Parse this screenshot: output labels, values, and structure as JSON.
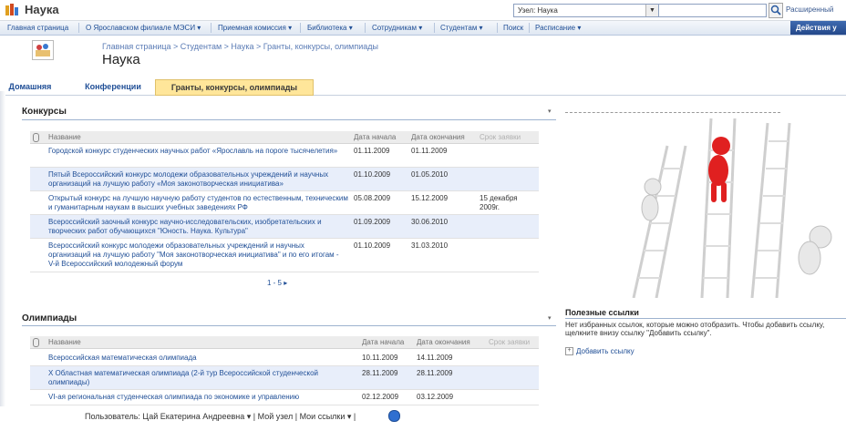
{
  "app": {
    "title": "Наука"
  },
  "search": {
    "scope": "Узел: Наука",
    "value": "",
    "advanced": "Расширенный"
  },
  "nav": {
    "items": [
      "Главная страница",
      "О Ярославском филиале МЭСИ ▾",
      "Приемная комиссия ▾",
      "Библиотека ▾",
      "Сотрудникам ▾",
      "Студентам ▾",
      "Поиск",
      "Расписание ▾"
    ],
    "actions": "Действия у"
  },
  "header": {
    "breadcrumb": "Главная страница > Студентам > Наука > Гранты, конкурсы, олимпиады",
    "title": "Наука"
  },
  "tabs": [
    "Домашняя",
    "Конференции",
    "Гранты, конкурсы, олимпиады"
  ],
  "contests": {
    "title": "Конкурсы",
    "columns": {
      "name": "Название",
      "start": "Дата начала",
      "end": "Дата окончания",
      "deadline": "Срок заявки"
    },
    "rows": [
      {
        "name": "Городской конкурс студенческих научных работ «Ярославль на пороге тысячелетия»",
        "start": "01.11.2009",
        "end": "01.11.2009",
        "deadline": ""
      },
      {
        "name": "Пятый Всероссийский конкурс молодежи образовательных учреждений и научных организаций на лучшую работу «Моя законотворческая инициатива»",
        "start": "01.10.2009",
        "end": "01.05.2010",
        "deadline": ""
      },
      {
        "name": "Открытый конкурс на лучшую научную работу студентов по естественным, техническим и гуманитарным наукам в высших учебных заведениях РФ",
        "start": "05.08.2009",
        "end": "15.12.2009",
        "deadline": "15 декабря 2009г."
      },
      {
        "name": "Всероссийский заочный конкурс научно-исследовательских, изобретательских и творческих работ обучающихся \"Юность. Наука. Культура\"",
        "start": "01.09.2009",
        "end": "30.06.2010",
        "deadline": ""
      },
      {
        "name": "Всероссийский конкурс молодежи образовательных учреждений и научных организаций на лучшую работу \"Моя законотворческая инициатива\" и по его итогам - V-й Всероссийский молодежный форум",
        "start": "01.10.2009",
        "end": "31.03.2010",
        "deadline": ""
      }
    ],
    "pager": "1 - 5 ▸"
  },
  "olympiads": {
    "title": "Олимпиады",
    "columns": {
      "name": "Название",
      "start": "Дата начала",
      "end": "Дата окончания",
      "deadline": "Срок заявки"
    },
    "rows": [
      {
        "name": "Всероссийская математическая олимпиада",
        "start": "10.11.2009",
        "end": "14.11.2009"
      },
      {
        "name": "X Областная математическая олимпиада (2-й тур Всероссийской студенческой олимпиады)",
        "start": "28.11.2009",
        "end": "28.11.2009"
      },
      {
        "name": "VI-ая региональная студенческая олимпиада по экономике и управлению",
        "start": "02.12.2009",
        "end": "03.12.2009"
      }
    ]
  },
  "useful_links": {
    "title": "Полезные ссылки",
    "empty_text": "Нет избранных ссылок, которые можно отобразить. Чтобы добавить ссылку, щелкните внизу ссылку \"Добавить ссылку\".",
    "add_link": "Добавить ссылку"
  },
  "status": {
    "text": "Пользователь: Цай Екатерина Андреевна ▾ | Мой узел | Мои ссылки ▾ |"
  },
  "colors": {
    "link": "#1f4e96",
    "accent_tab": "#ffe69a",
    "alt_row": "#e8eefa",
    "figure_red": "#e02020"
  }
}
